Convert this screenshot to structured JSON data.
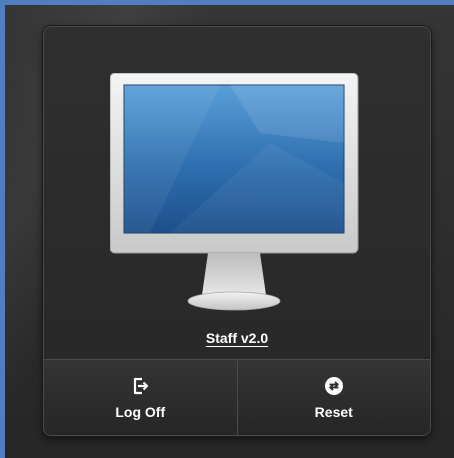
{
  "desktop": {
    "name": "Staff v2.0"
  },
  "actions": [
    {
      "label": "Log Off",
      "icon": "log-off-icon"
    },
    {
      "label": "Reset",
      "icon": "reset-icon"
    }
  ],
  "colors": {
    "frame_accent": "#4f7fc0",
    "card_background": "#2b2b2b",
    "screen_blue": "#2f6fb0",
    "text": "#ffffff"
  }
}
